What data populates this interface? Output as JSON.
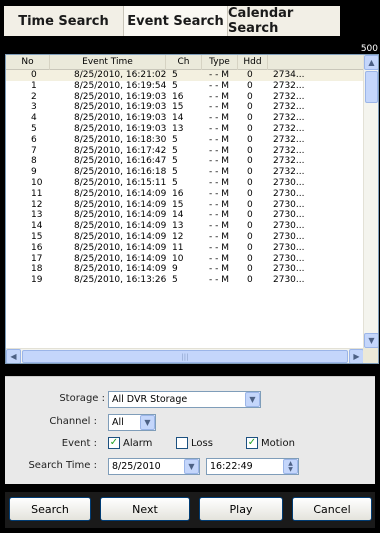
{
  "tabs": [
    {
      "label": "Time Search"
    },
    {
      "label": "Event Search"
    },
    {
      "label": "Calendar Search"
    }
  ],
  "event_count": "500",
  "table": {
    "columns": [
      "No",
      "Event Time",
      "Ch",
      "Type",
      "Hdd"
    ],
    "rows": [
      {
        "no": "0",
        "time": "8/25/2010, 16:21:02",
        "ch": "5",
        "type": "- - M",
        "hdd": "0",
        "extra": "2734..."
      },
      {
        "no": "1",
        "time": "8/25/2010, 16:19:54",
        "ch": "5",
        "type": "- - M",
        "hdd": "0",
        "extra": "2732..."
      },
      {
        "no": "2",
        "time": "8/25/2010, 16:19:03",
        "ch": "16",
        "type": "- - M",
        "hdd": "0",
        "extra": "2732..."
      },
      {
        "no": "3",
        "time": "8/25/2010, 16:19:03",
        "ch": "15",
        "type": "- - M",
        "hdd": "0",
        "extra": "2732..."
      },
      {
        "no": "4",
        "time": "8/25/2010, 16:19:03",
        "ch": "14",
        "type": "- - M",
        "hdd": "0",
        "extra": "2732..."
      },
      {
        "no": "5",
        "time": "8/25/2010, 16:19:03",
        "ch": "13",
        "type": "- - M",
        "hdd": "0",
        "extra": "2732..."
      },
      {
        "no": "6",
        "time": "8/25/2010, 16:18:30",
        "ch": "5",
        "type": "- - M",
        "hdd": "0",
        "extra": "2732..."
      },
      {
        "no": "7",
        "time": "8/25/2010, 16:17:42",
        "ch": "5",
        "type": "- - M",
        "hdd": "0",
        "extra": "2732..."
      },
      {
        "no": "8",
        "time": "8/25/2010, 16:16:47",
        "ch": "5",
        "type": "- - M",
        "hdd": "0",
        "extra": "2732..."
      },
      {
        "no": "9",
        "time": "8/25/2010, 16:16:18",
        "ch": "5",
        "type": "- - M",
        "hdd": "0",
        "extra": "2732..."
      },
      {
        "no": "10",
        "time": "8/25/2010, 16:15:11",
        "ch": "5",
        "type": "- - M",
        "hdd": "0",
        "extra": "2730..."
      },
      {
        "no": "11",
        "time": "8/25/2010, 16:14:09",
        "ch": "16",
        "type": "- - M",
        "hdd": "0",
        "extra": "2730..."
      },
      {
        "no": "12",
        "time": "8/25/2010, 16:14:09",
        "ch": "15",
        "type": "- - M",
        "hdd": "0",
        "extra": "2730..."
      },
      {
        "no": "13",
        "time": "8/25/2010, 16:14:09",
        "ch": "14",
        "type": "- - M",
        "hdd": "0",
        "extra": "2730..."
      },
      {
        "no": "14",
        "time": "8/25/2010, 16:14:09",
        "ch": "13",
        "type": "- - M",
        "hdd": "0",
        "extra": "2730..."
      },
      {
        "no": "15",
        "time": "8/25/2010, 16:14:09",
        "ch": "12",
        "type": "- - M",
        "hdd": "0",
        "extra": "2730..."
      },
      {
        "no": "16",
        "time": "8/25/2010, 16:14:09",
        "ch": "11",
        "type": "- - M",
        "hdd": "0",
        "extra": "2730..."
      },
      {
        "no": "17",
        "time": "8/25/2010, 16:14:09",
        "ch": "10",
        "type": "- - M",
        "hdd": "0",
        "extra": "2730..."
      },
      {
        "no": "18",
        "time": "8/25/2010, 16:14:09",
        "ch": "9",
        "type": "- - M",
        "hdd": "0",
        "extra": "2730..."
      },
      {
        "no": "19",
        "time": "8/25/2010, 16:13:26",
        "ch": "5",
        "type": "- - M",
        "hdd": "0",
        "extra": "2730..."
      }
    ]
  },
  "filters": {
    "storage_label": "Storage :",
    "storage_value": "All DVR Storage",
    "channel_label": "Channel :",
    "channel_value": "All",
    "event_label": "Event :",
    "alarm_label": "Alarm",
    "alarm_checked": true,
    "loss_label": "Loss",
    "loss_checked": false,
    "motion_label": "Motion",
    "motion_checked": true,
    "search_time_label": "Search Time :",
    "date_value": "8/25/2010",
    "time_value": "16:22:49"
  },
  "buttons": {
    "search": "Search",
    "next": "Next",
    "play": "Play",
    "cancel": "Cancel"
  },
  "icons": {
    "dropdown": "chevron-down-icon",
    "scroll_up": "arrow-up-icon",
    "scroll_down": "arrow-down-icon",
    "scroll_left": "arrow-left-icon",
    "scroll_right": "arrow-right-icon",
    "spinner": "spinner-icon",
    "check": "checkmark-icon"
  },
  "colors": {
    "scrollbar": "#c4d6fb",
    "check": "#21a121",
    "button_border": "#003c74"
  }
}
